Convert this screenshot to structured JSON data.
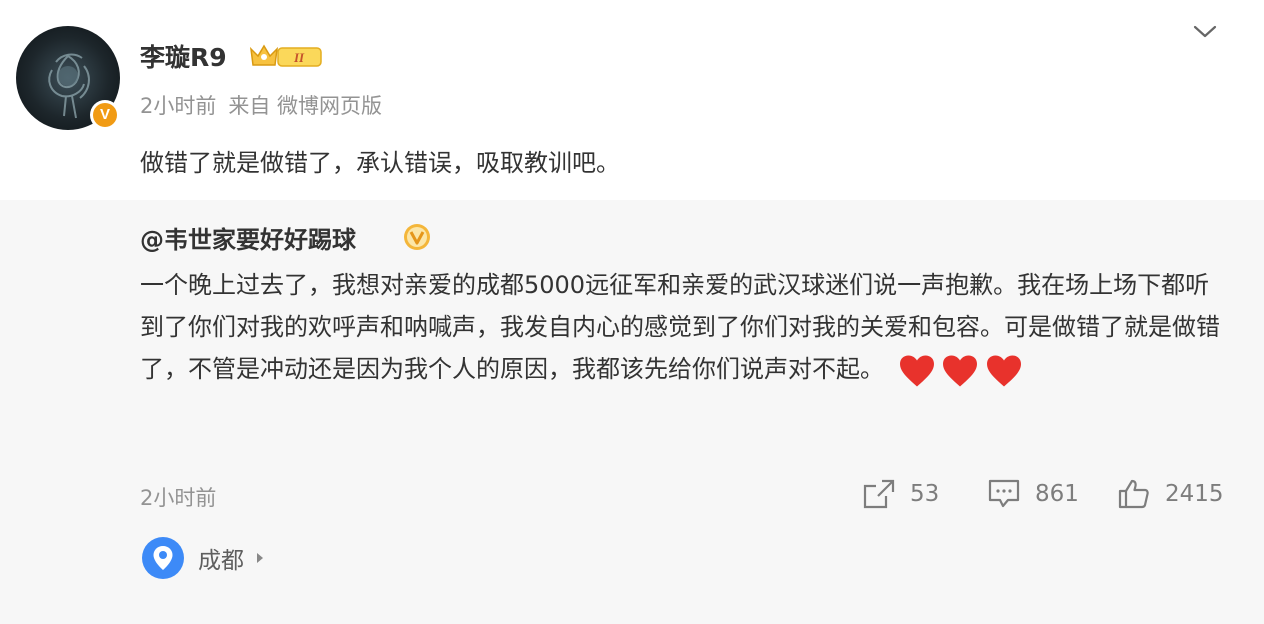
{
  "post": {
    "username": "李璇R9",
    "badge_text": "II",
    "time": "2小时前",
    "source": "来自 微博网页版",
    "text": "做错了就是做错了，承认错误，吸取教训吧。"
  },
  "repost": {
    "author": "@韦世家要好好踢球",
    "text": "一个晚上过去了，我想对亲爱的成都5000远征军和亲爱的武汉球迷们说一声抱歉。我在场上场下都听到了你们对我的欢呼声和呐喊声，我发自内心的感觉到了你们对我的关爱和包容。可是做错了就是做错了，不管是冲动还是因为我个人的原因，我都该先给你们说声对不起。",
    "emoji": "❤❤❤",
    "time": "2小时前",
    "actions": {
      "share_count": "53",
      "comment_count": "861",
      "like_count": "2415"
    },
    "location": "成都"
  },
  "colors": {
    "accent_orange": "#f19b14",
    "location_blue": "#3d8af7",
    "heart_red": "#e8322c",
    "muted_text": "#939393"
  },
  "icons": {
    "verified": "v-badge-icon",
    "crown": "crown-badge-icon",
    "expand": "chevron-down-icon",
    "share": "share-icon",
    "comment": "comment-icon",
    "like": "thumbs-up-icon",
    "location": "location-pin-icon"
  }
}
